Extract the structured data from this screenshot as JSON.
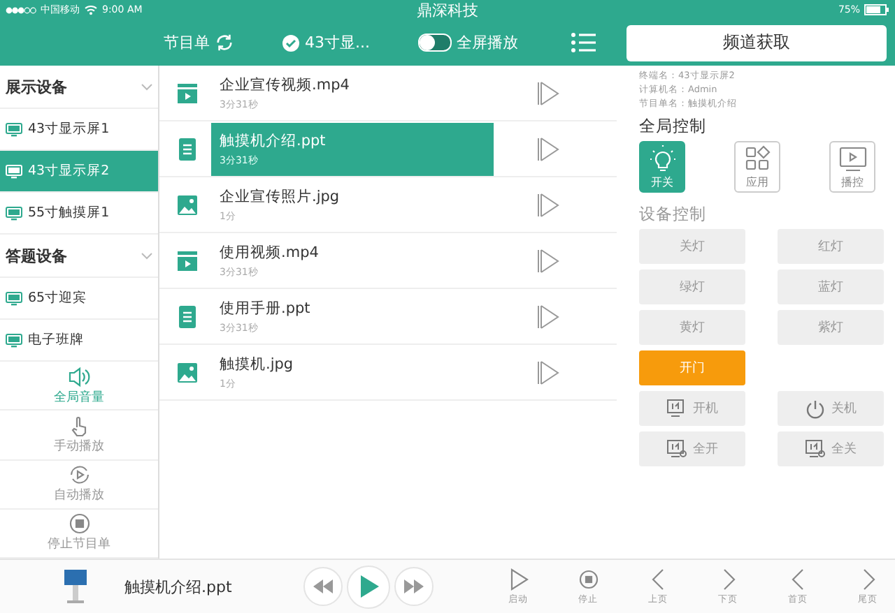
{
  "status_bar": {
    "carrier": "中国移动",
    "time": "9:00 AM",
    "title": "鼎深科技",
    "battery": "75%"
  },
  "header": {
    "playlist": "节目单",
    "device": "43寸显...",
    "fullscreen": {
      "label": "全屏播放",
      "on": false
    },
    "fetch_button": "频道获取"
  },
  "sidebar": {
    "groups": [
      {
        "title": "展示设备",
        "expanded": true,
        "items": [
          {
            "label": "43寸显示屏1",
            "selected": false
          },
          {
            "label": "43寸显示屏2",
            "selected": true
          },
          {
            "label": "55寸触摸屏1",
            "selected": false
          }
        ]
      },
      {
        "title": "答题设备",
        "expanded": true,
        "items": [
          {
            "label": "65寸迎宾",
            "selected": false
          },
          {
            "label": "电子班牌",
            "selected": false
          }
        ]
      }
    ],
    "actions": [
      {
        "kind": "volume",
        "label": "全局音量",
        "selected": true
      },
      {
        "kind": "manual",
        "label": "手动播放",
        "selected": false
      },
      {
        "kind": "auto",
        "label": "自动播放",
        "selected": false
      },
      {
        "kind": "stop",
        "label": "停止节目单",
        "selected": false
      }
    ]
  },
  "files": [
    {
      "kind": "video",
      "name": "企业宣传视频.mp4",
      "duration": "3分31秒",
      "selected": false
    },
    {
      "kind": "doc",
      "name": "触摸机介绍.ppt",
      "duration": "3分31秒",
      "selected": true
    },
    {
      "kind": "image",
      "name": "企业宣传照片.jpg",
      "duration": "1分",
      "selected": false
    },
    {
      "kind": "video",
      "name": "使用视频.mp4",
      "duration": "3分31秒",
      "selected": false
    },
    {
      "kind": "doc",
      "name": "使用手册.ppt",
      "duration": "3分31秒",
      "selected": false
    },
    {
      "kind": "image",
      "name": "触摸机.jpg",
      "duration": "1分",
      "selected": false
    }
  ],
  "info": [
    "终端名：43寸显示屏2",
    "计算机名：Admin",
    "节目单名：触摸机介绍"
  ],
  "global_control": {
    "title": "全局控制",
    "buttons": [
      {
        "kind": "bulb",
        "label": "开关",
        "selected": true
      },
      {
        "kind": "apps",
        "label": "应用",
        "selected": false
      },
      {
        "kind": "screen",
        "label": "播控",
        "selected": false
      }
    ]
  },
  "device_control": {
    "title": "设备控制",
    "buttons": [
      {
        "kind": "plain",
        "label": "关灯"
      },
      {
        "kind": "plain",
        "label": "红灯"
      },
      {
        "kind": "plain",
        "label": "绿灯"
      },
      {
        "kind": "plain",
        "label": "蓝灯"
      },
      {
        "kind": "plain",
        "label": "黄灯"
      },
      {
        "kind": "plain",
        "label": "紫灯"
      },
      {
        "kind": "accent",
        "label": "开门"
      },
      {
        "kind": "blank"
      },
      {
        "kind": "screen",
        "label": "开机"
      },
      {
        "kind": "power",
        "label": "关机"
      },
      {
        "kind": "screen-all",
        "label": "全开"
      },
      {
        "kind": "screen-all",
        "label": "全关"
      }
    ]
  },
  "player": {
    "title": "触摸机介绍.ppt",
    "controls": [
      {
        "kind": "start",
        "label": "启动"
      },
      {
        "kind": "stop",
        "label": "停止"
      },
      {
        "kind": "prev",
        "label": "上页"
      },
      {
        "kind": "next",
        "label": "下页"
      },
      {
        "kind": "first",
        "label": "首页"
      },
      {
        "kind": "last",
        "label": "尾页"
      }
    ]
  }
}
